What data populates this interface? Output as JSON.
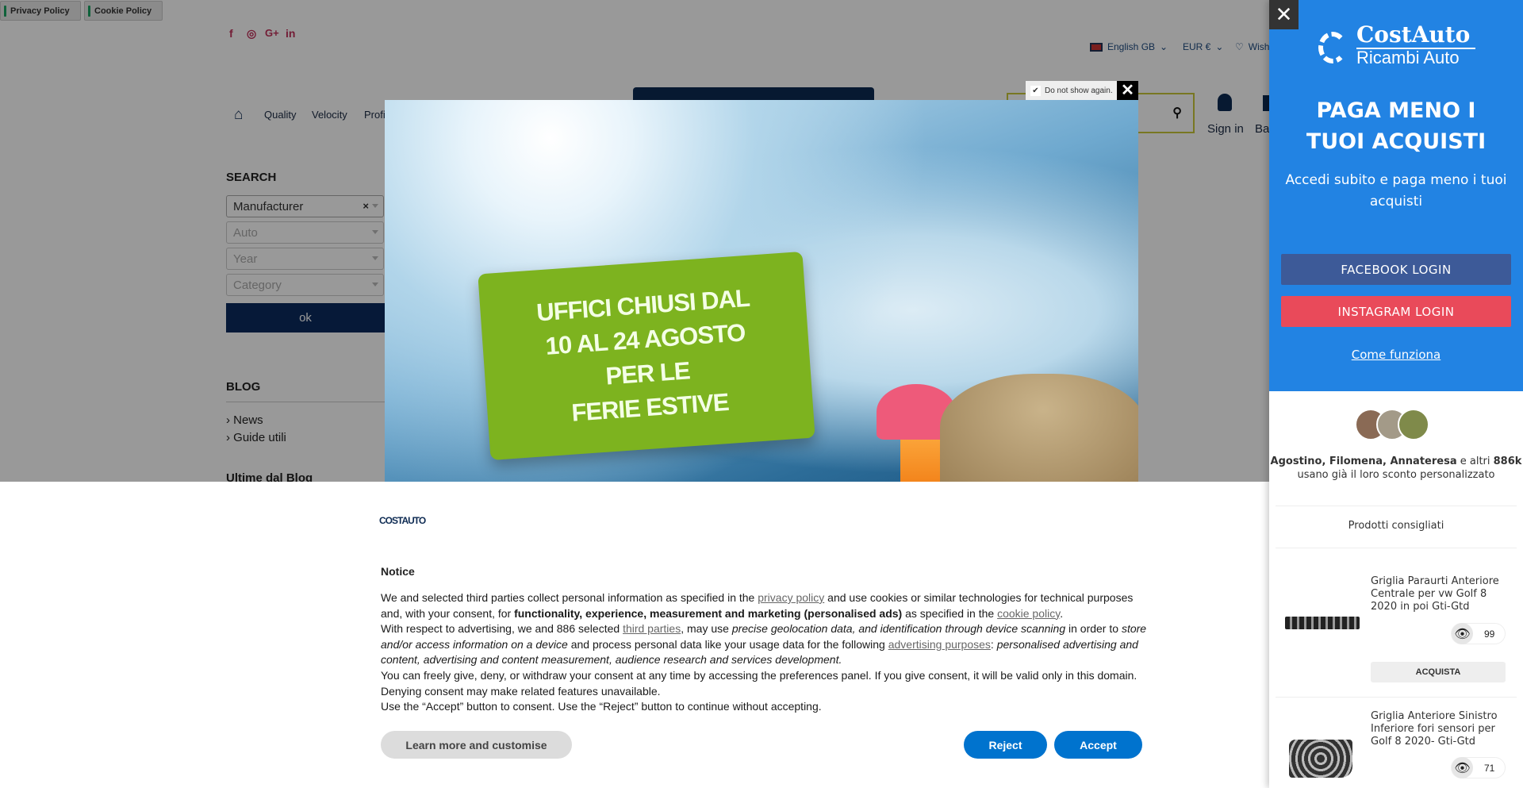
{
  "policy_bar": {
    "privacy": "Privacy Policy",
    "cookie": "Cookie Policy"
  },
  "header": {
    "social": [
      {
        "icon": "facebook-icon",
        "glyph": "f"
      },
      {
        "icon": "instagram-icon",
        "glyph": "◎"
      },
      {
        "icon": "google-plus-icon",
        "glyph": "G+"
      },
      {
        "icon": "linkedin-icon",
        "glyph": "in"
      }
    ],
    "language": "English GB",
    "currency": "EUR €",
    "wishlist": "Wish",
    "nav": [
      "Quality",
      "Velocity",
      "Profi"
    ],
    "sign_in": "Sign in",
    "basket": "Ba"
  },
  "sidebar": {
    "search_title": "SEARCH",
    "selects": {
      "manufacturer": "Manufacturer",
      "auto": "Auto",
      "year": "Year",
      "category": "Category"
    },
    "ok": "ok",
    "blog_title": "BLOG",
    "blog_items": [
      "News",
      "Guide utili"
    ],
    "latest_title": "Ultime dal Blog"
  },
  "popup": {
    "do_not_show": "Do not show again.",
    "lines": [
      "UFFICI CHIUSI DAL",
      "10 AL 24 AGOSTO",
      "PER LE",
      "FERIE ESTIVE"
    ],
    "card_color": "#7db31f"
  },
  "cookie": {
    "logo": "COSTAUTO",
    "title": "Notice",
    "p1_a": "We and selected third parties collect personal information as specified in the ",
    "p1_link1": "privacy policy",
    "p1_b": " and use cookies or similar technologies for technical purposes and, with your consent, for ",
    "p1_bold": "functionality, experience, measurement and marketing (personalised ads)",
    "p1_c": " as specified in the ",
    "p1_link2": "cookie policy",
    "p1_d": ".",
    "p2_a": "With respect to advertising, we and 886 selected ",
    "p2_link1": "third parties",
    "p2_b": ", may use ",
    "p2_i1": "precise geolocation data, and identification through device scanning",
    "p2_c": " in order to ",
    "p2_i2": "store and/or access information on a device",
    "p2_d": " and process personal data like your usage data for the following ",
    "p2_link2": "advertising purposes",
    "p2_e": ": ",
    "p2_i3": "personalised advertising and content, advertising and content measurement, audience research and services development.",
    "p3": "You can freely give, deny, or withdraw your consent at any time by accessing the preferences panel. If you give consent, it will be valid only in this domain. Denying consent may make related features unavailable.",
    "p4": "Use the “Accept” button to consent. Use the “Reject” button to continue without accepting.",
    "learn_more": "Learn more and customise",
    "reject": "Reject",
    "accept": "Accept",
    "accent": "#0073ce"
  },
  "panel": {
    "logo_top": "CostAuto",
    "logo_bottom": "Ricambi Auto",
    "heading": "PAGA MENO I TUOI ACQUISTI",
    "subtitle": "Accedi subito e paga meno i tuoi acquisti",
    "facebook": "FACEBOOK LOGIN",
    "instagram": "INSTAGRAM LOGIN",
    "how": "Come funziona",
    "names": "Agostino, Filomena, Annateresa",
    "others_prefix": " e altri ",
    "others_count": "886k",
    "social_proof": "usano già il loro sconto personalizzato",
    "recommended": "Prodotti consigliati",
    "products": [
      {
        "title": "Griglia Paraurti Anteriore Centrale per vw Golf 8 2020 in poi Gti-Gtd",
        "views": "99",
        "buy": "ACQUISTA"
      },
      {
        "title": "Griglia Anteriore Sinistro Inferiore fori sensori per Golf 8 2020- Gti-Gtd",
        "views": "71"
      }
    ],
    "colors": {
      "blue": "#2283e3",
      "facebook": "#3d5a98",
      "instagram": "#e94a5a"
    }
  }
}
